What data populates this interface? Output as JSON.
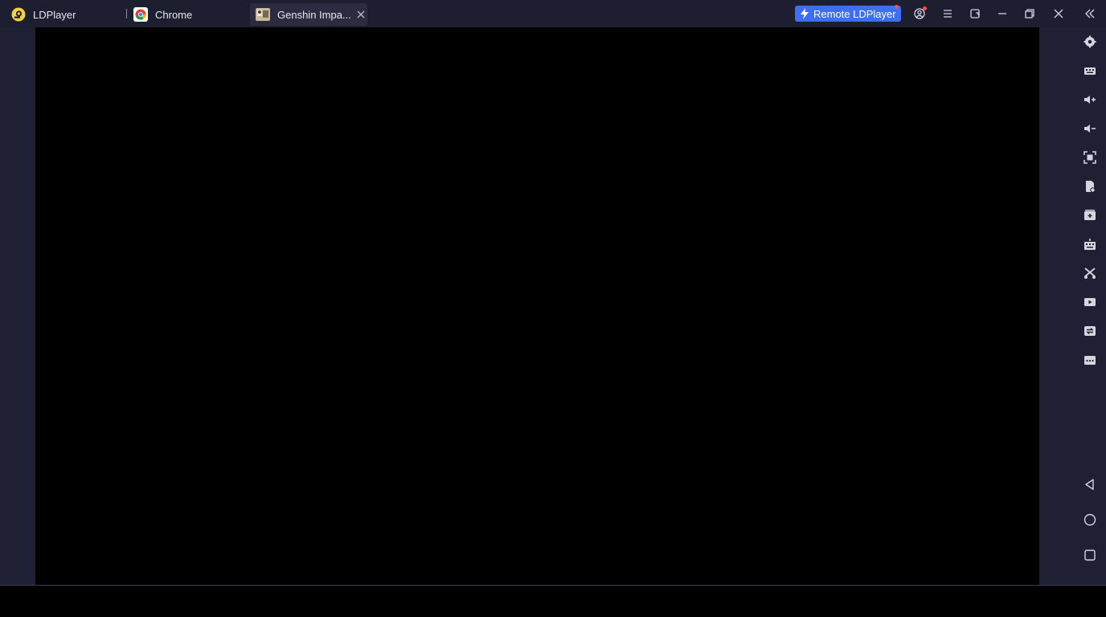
{
  "tabs": {
    "home": {
      "label": "LDPlayer",
      "icon": "ldplayer-logo-icon"
    },
    "chrome": {
      "label": "Chrome",
      "icon": "chrome-icon"
    },
    "game": {
      "label": "Genshin Impa...",
      "icon": "genshin-impact-icon"
    }
  },
  "titlebar": {
    "remote_label": "Remote LDPlayer",
    "controls": [
      "user-account-icon",
      "menu-icon",
      "mini-window-icon",
      "minimize-icon",
      "restore-icon",
      "close-icon",
      "collapse-sidebar-icon"
    ]
  },
  "sidebar": {
    "top_items": [
      "settings-icon",
      "keyboard-mapping-icon",
      "volume-up-icon",
      "volume-down-icon",
      "fullscreen-icon",
      "install-apk-icon",
      "add-app-icon",
      "virtual-keyboard-icon",
      "scissors-icon",
      "record-video-icon",
      "sync-icon",
      "more-icon"
    ],
    "nav_items": [
      "back-icon",
      "home-icon",
      "recent-apps-icon"
    ]
  },
  "colors": {
    "window_bg": "#1f2033",
    "titlebar_bg": "#1d1e2f",
    "active_tab_bg": "#2b2c40",
    "accent": "#3e6ff3",
    "notification": "#ff4d4d",
    "screen_bg": "#000000"
  }
}
